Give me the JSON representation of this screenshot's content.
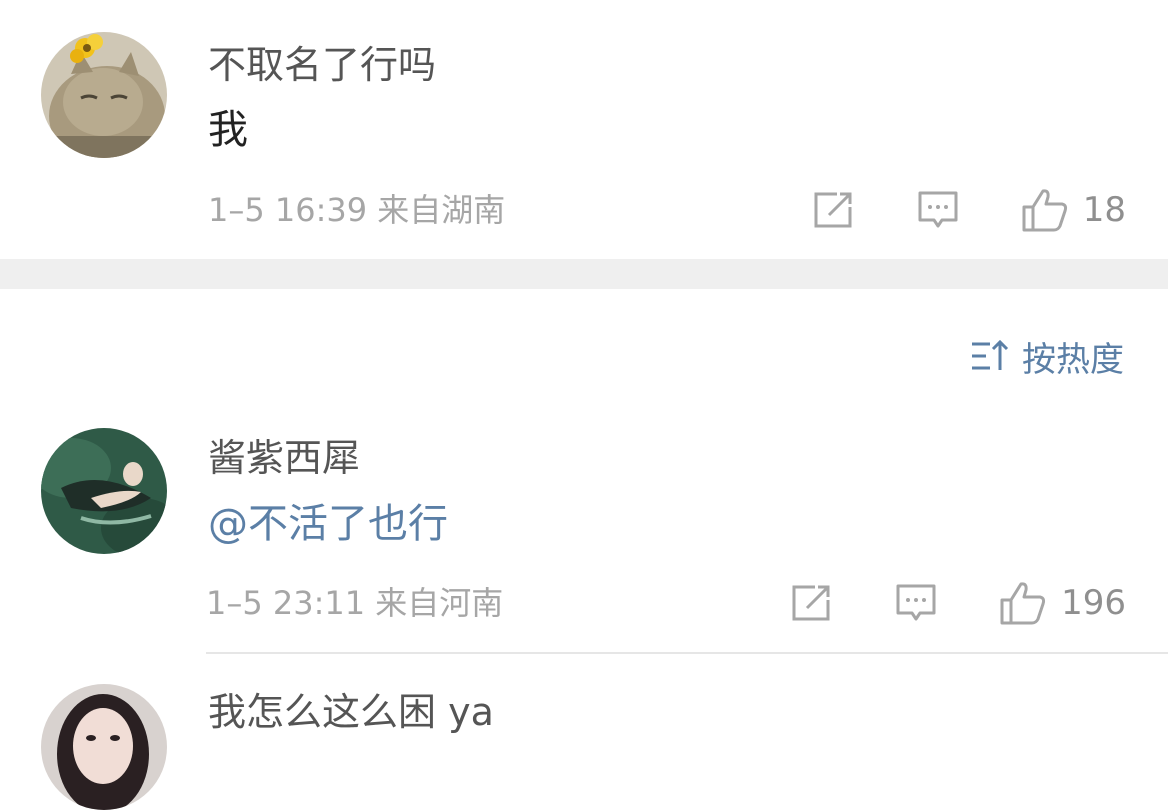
{
  "comments": [
    {
      "username": "不取名了行吗",
      "content": "我",
      "meta": "1–5 16:39  来自湖南",
      "like_count": "18"
    },
    {
      "username": "酱紫西犀",
      "content": "@不活了也行",
      "meta": "1–5 23:11  来自河南",
      "like_count": "196"
    },
    {
      "username": "我怎么这么困 ya"
    }
  ],
  "sort": {
    "label": "按热度"
  },
  "icons": {
    "share": "share-icon",
    "reply": "comment-icon",
    "like": "thumbs-up-icon",
    "sort": "sort-icon"
  },
  "colors": {
    "accent": "#5b7fa6",
    "meta_text": "#a6a6a6",
    "separator": "#efefef"
  }
}
